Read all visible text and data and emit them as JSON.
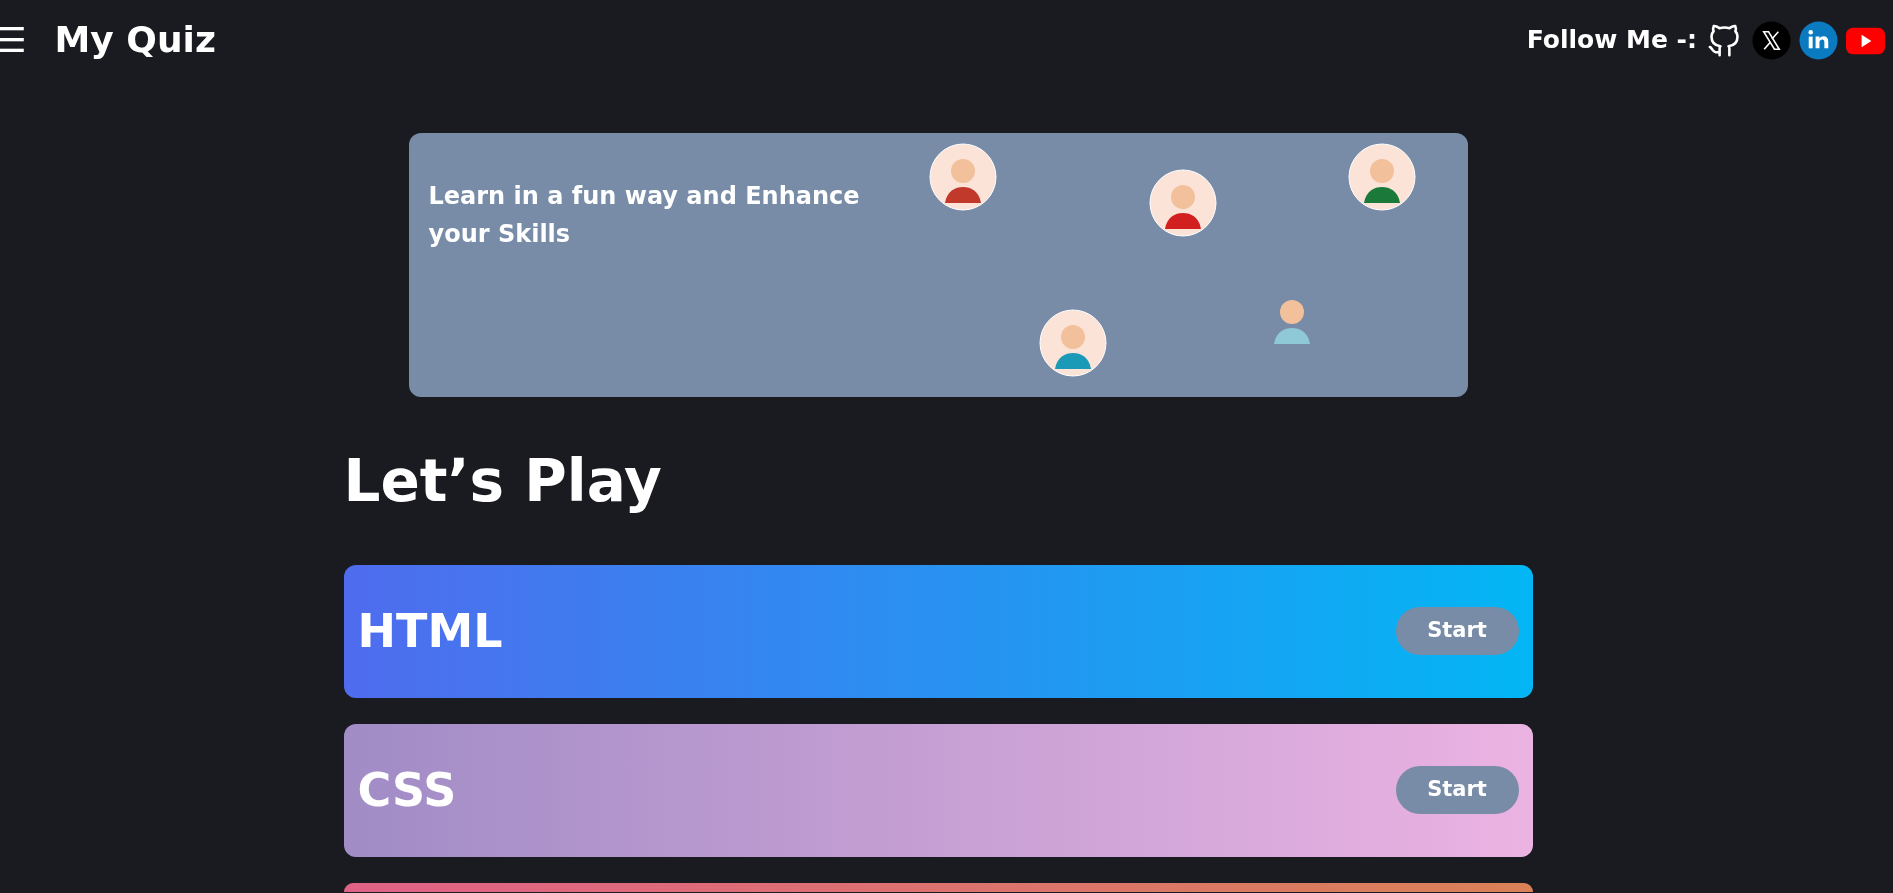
{
  "navbar": {
    "menu_icon": "☰",
    "brand": "My Quiz",
    "follow_label": "Follow Me -:",
    "social": [
      {
        "kind": "github"
      },
      {
        "kind": "x"
      },
      {
        "kind": "linkedin"
      },
      {
        "kind": "youtube"
      }
    ]
  },
  "banner": {
    "text": "Learn in a fun way and Enhance your Skills",
    "avatars": [
      {
        "kind": "circle"
      },
      {
        "kind": "circle"
      },
      {
        "kind": "circle"
      },
      {
        "kind": "circle"
      },
      {
        "kind": "plain"
      }
    ]
  },
  "heading": "Let’s Play",
  "quizzes": [
    {
      "title": "HTML",
      "button": "Start"
    },
    {
      "title": "CSS",
      "button": "Start"
    },
    {
      "kind": "partial"
    }
  ]
}
